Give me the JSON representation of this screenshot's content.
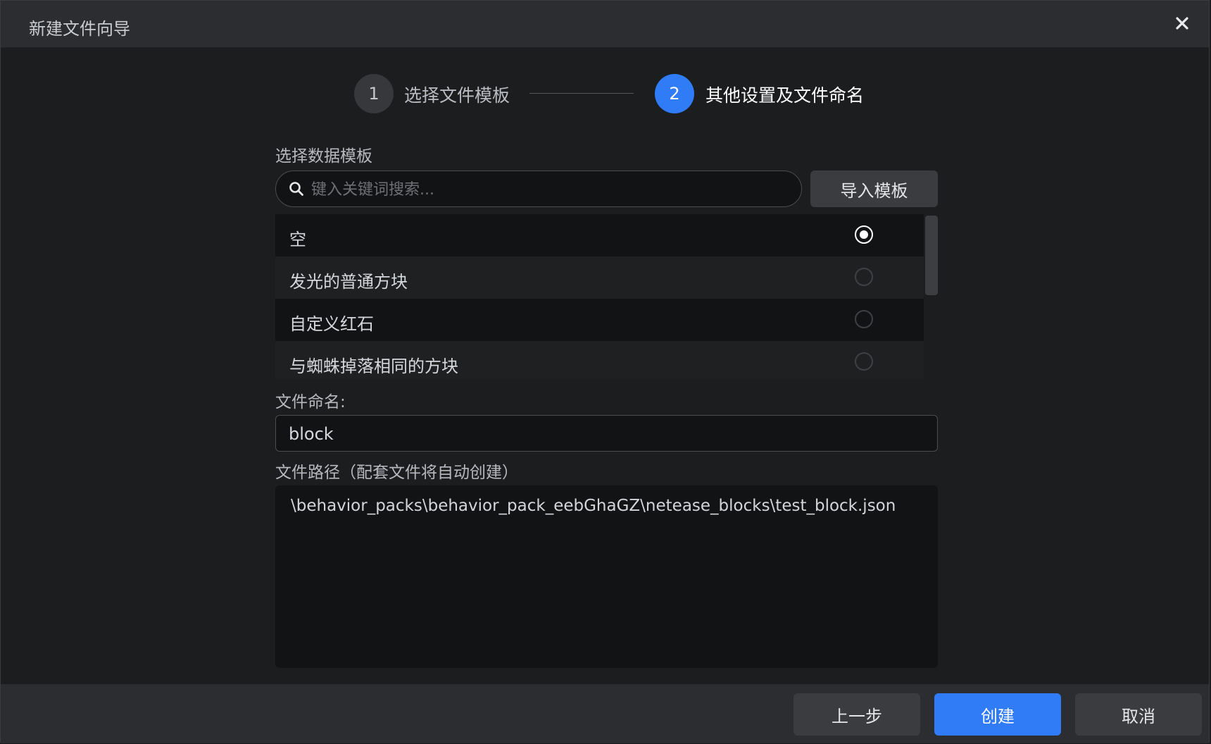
{
  "window": {
    "title": "新建文件向导"
  },
  "steps": [
    {
      "number": "1",
      "label": "选择文件模板",
      "state": "done"
    },
    {
      "number": "2",
      "label": "其他设置及文件命名",
      "state": "active"
    }
  ],
  "template_section": {
    "label": "选择数据模板",
    "search_placeholder": "键入关键词搜索...",
    "import_label": "导入模板",
    "items": [
      {
        "label": "空",
        "selected": true
      },
      {
        "label": "发光的普通方块",
        "selected": false
      },
      {
        "label": "自定义红石",
        "selected": false
      },
      {
        "label": "与蜘蛛掉落相同的方块",
        "selected": false
      }
    ]
  },
  "filename": {
    "label": "文件命名:",
    "value": "block"
  },
  "filepath": {
    "label": "文件路径（配套文件将自动创建）",
    "value": "\\behavior_packs\\behavior_pack_eebGhaGZ\\netease_blocks\\test_block.json"
  },
  "footer": {
    "prev_label": "上一步",
    "create_label": "创建",
    "cancel_label": "取消"
  },
  "colors": {
    "accent": "#2f7cf6",
    "background": "#1c1d1f",
    "panel": "#2b2d30"
  }
}
